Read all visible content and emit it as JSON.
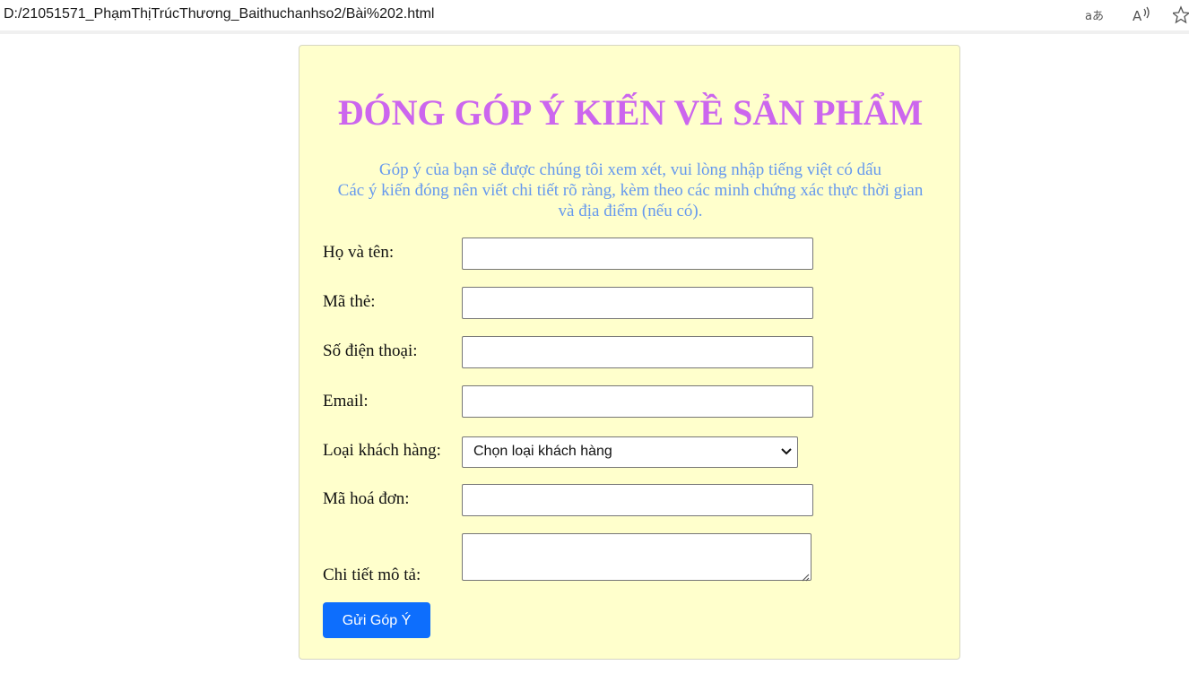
{
  "browser": {
    "url": "D:/21051571_PhạmThịTrúcThương_Baithuchanhso2/Bài%202.html",
    "icons": [
      "translate-icon",
      "read-aloud-icon",
      "favorite-star-icon"
    ]
  },
  "form": {
    "title": "ĐÓNG GÓP Ý KIẾN VỀ SẢN PHẨM",
    "description_lines": [
      "Góp ý của bạn sẽ được chúng tôi xem xét, vui lòng nhập tiếng việt có dấu",
      "Các ý kiến đóng nên viết chi tiết rõ ràng, kèm theo các minh chứng xác thực thời gian",
      "và địa điểm (nếu có)."
    ],
    "fields": {
      "fullname": {
        "label": "Họ và tên:",
        "value": ""
      },
      "card_id": {
        "label": "Mã thẻ:",
        "value": ""
      },
      "phone": {
        "label": "Số điện thoại:",
        "value": ""
      },
      "email": {
        "label": "Email:",
        "value": ""
      },
      "customer_type": {
        "label": "Loại khách hàng:",
        "selected": "Chọn loại khách hàng"
      },
      "invoice_id": {
        "label": "Mã hoá đơn:",
        "value": ""
      },
      "details": {
        "label": "Chi tiết mô tả:",
        "value": ""
      }
    },
    "submit_label": "Gửi Góp Ý",
    "colors": {
      "card_bg": "#ffffcc",
      "title": "#cc66ee",
      "description": "#6699ee",
      "button": "#0d6efd"
    }
  }
}
